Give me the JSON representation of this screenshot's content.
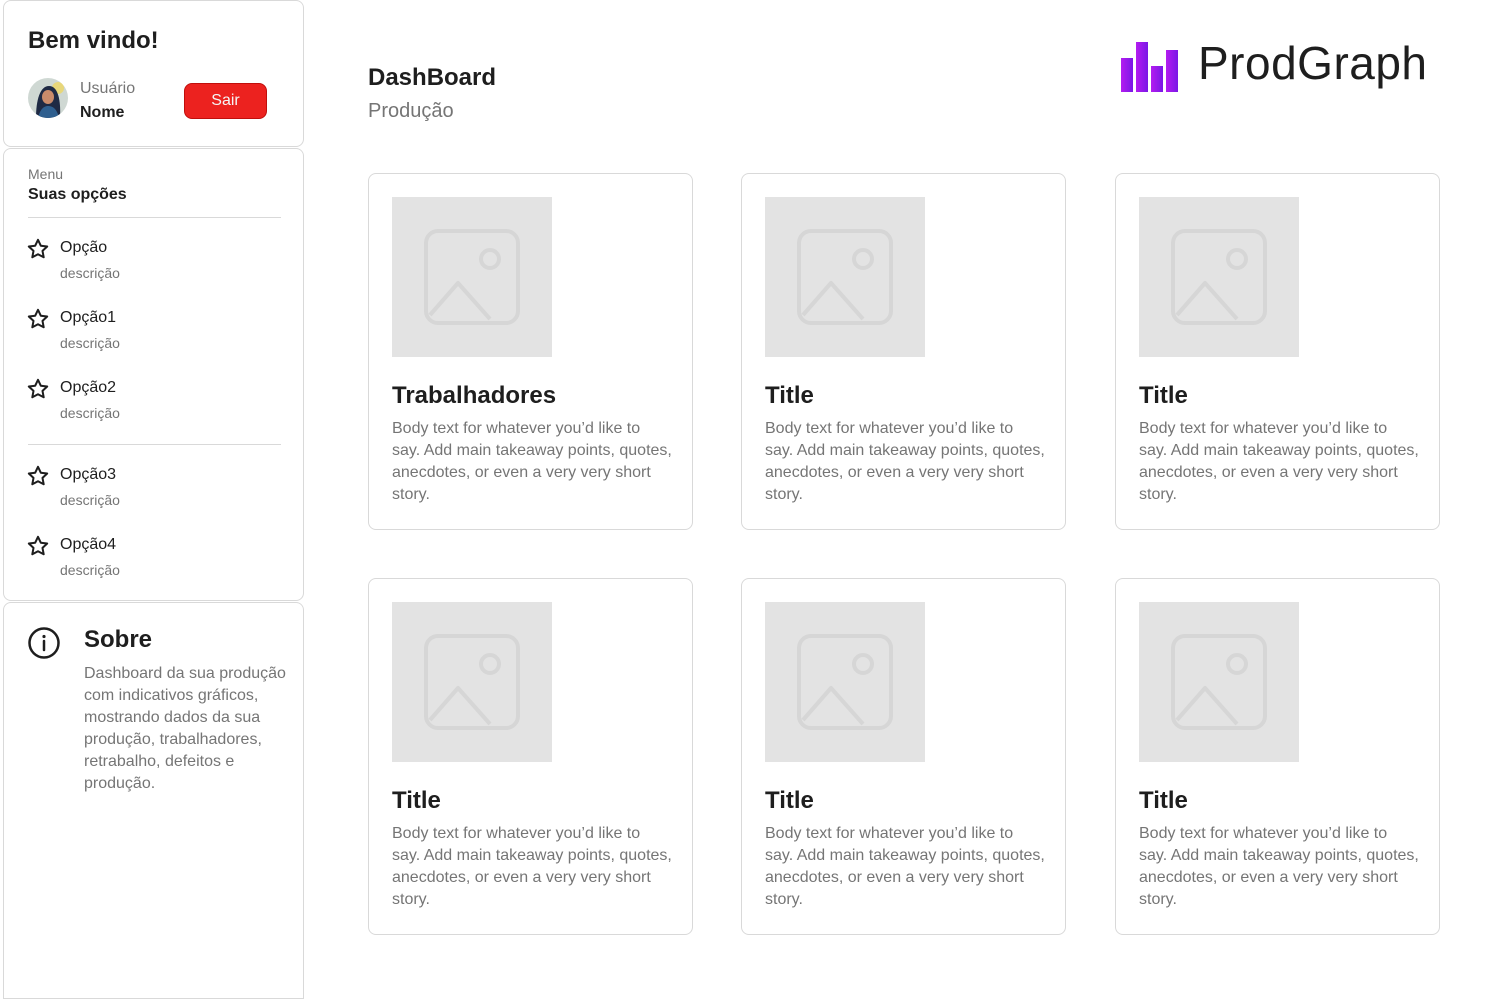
{
  "welcome": {
    "title": "Bem vindo!",
    "user_label": "Usuário",
    "user_name": "Nome",
    "logout_label": "Sair"
  },
  "menu": {
    "eyebrow": "Menu",
    "heading": "Suas opções",
    "items": [
      {
        "label": "Opção",
        "description": "descrição",
        "icon": "star-icon"
      },
      {
        "label": "Opção1",
        "description": "descrição",
        "icon": "star-icon"
      },
      {
        "label": "Opção2",
        "description": "descrição",
        "icon": "star-icon"
      },
      {
        "label": "Opção3",
        "description": "descrição",
        "icon": "star-icon"
      },
      {
        "label": "Opção4",
        "description": "descrição",
        "icon": "star-icon"
      }
    ]
  },
  "about": {
    "icon": "info-icon",
    "title": "Sobre",
    "text": "Dashboard da sua produção com indicativos gráficos, mostrando dados da sua produção, trabalhadores, retrabalho, defeitos e produção."
  },
  "header": {
    "title": "DashBoard",
    "subtitle": "Produção",
    "logo_text": "ProdGraph",
    "logo_color": "#a020f0"
  },
  "cards": [
    {
      "title": "Trabalhadores",
      "body": "Body text for whatever you’d like to say. Add main takeaway points, quotes, anecdotes, or even a very very short story."
    },
    {
      "title": "Title",
      "body": "Body text for whatever you’d like to say. Add main takeaway points, quotes, anecdotes, or even a very very short story."
    },
    {
      "title": "Title",
      "body": "Body text for whatever you’d like to say. Add main takeaway points, quotes, anecdotes, or even a very very short story."
    },
    {
      "title": "Title",
      "body": "Body text for whatever you’d like to say. Add main takeaway points, quotes, anecdotes, or even a very very short story."
    },
    {
      "title": "Title",
      "body": "Body text for whatever you’d like to say. Add main takeaway points, quotes, anecdotes, or even a very very short story."
    },
    {
      "title": "Title",
      "body": "Body text for whatever you’d like to say. Add main takeaway points, quotes, anecdotes, or even a very very short story."
    }
  ],
  "colors": {
    "accent_red": "#ec221f",
    "text_primary": "#1e1e1e",
    "text_secondary": "#757575",
    "border": "#d9d9d9",
    "placeholder": "#e3e3e3"
  }
}
